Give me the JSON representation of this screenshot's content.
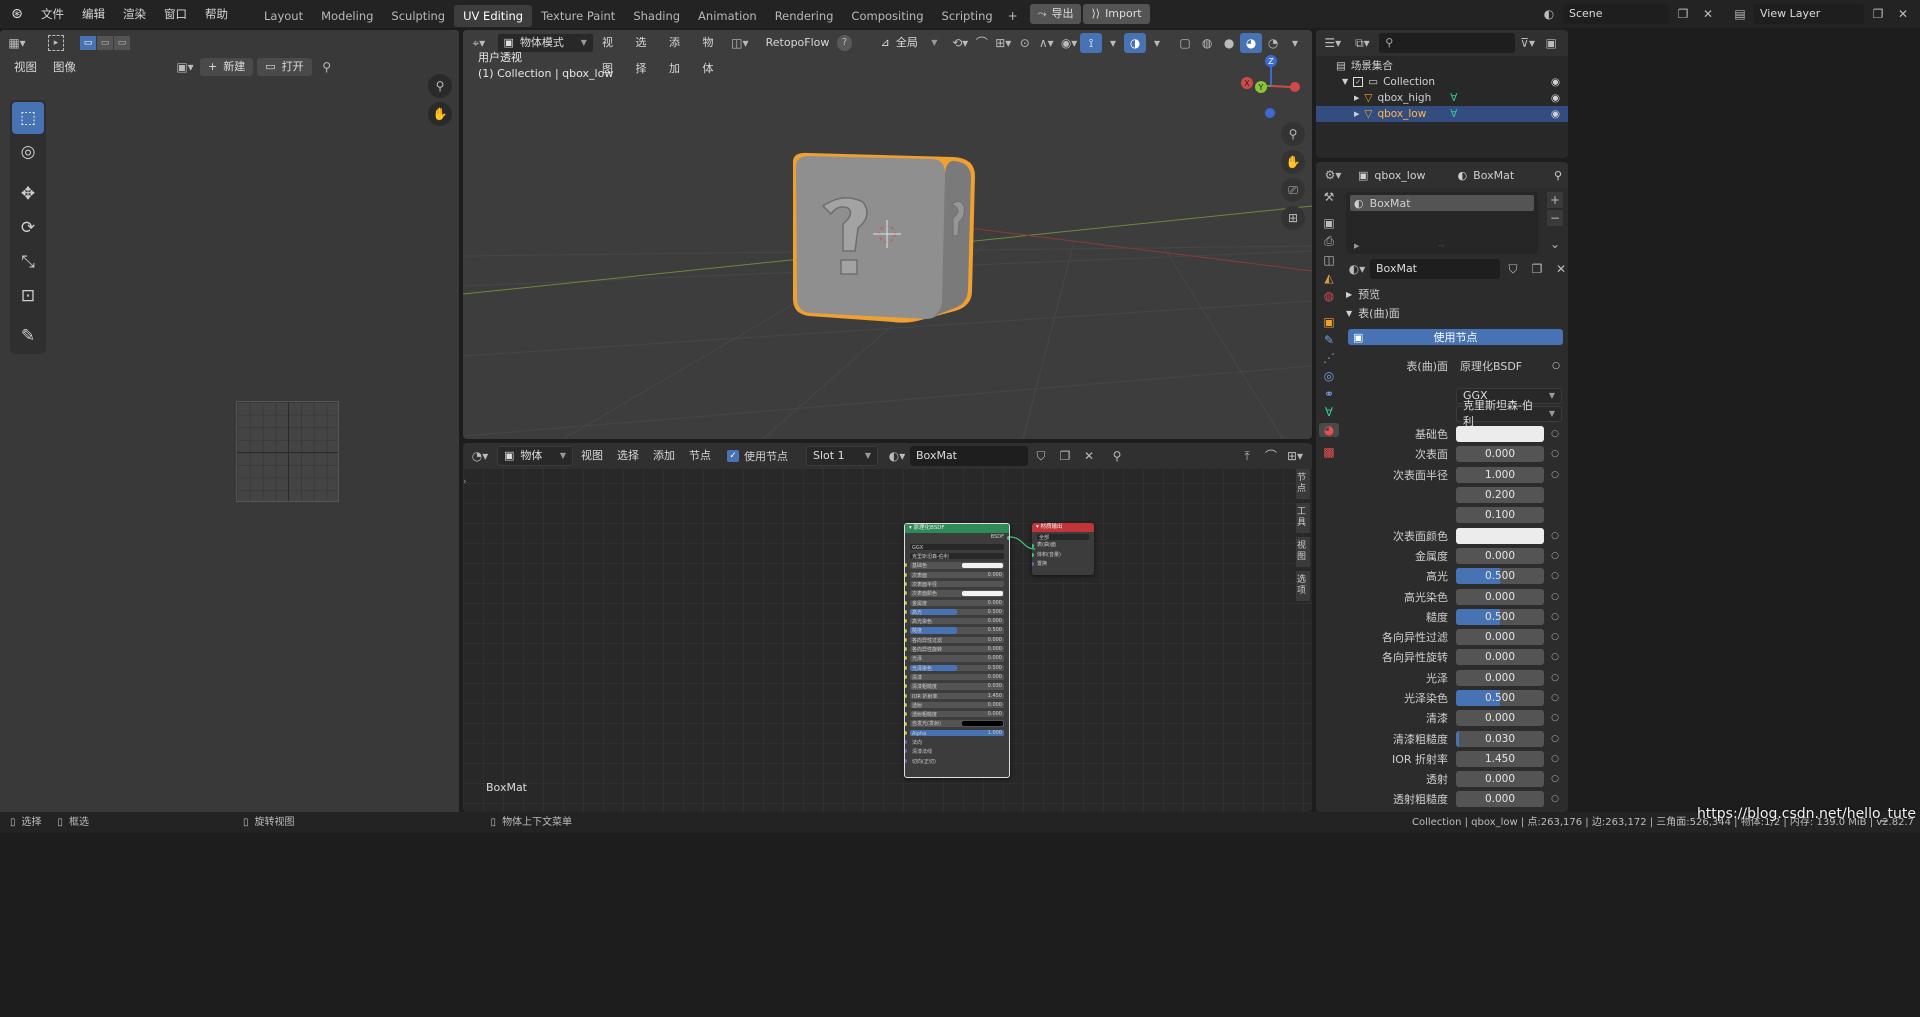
{
  "topbar": {
    "menus": [
      "文件",
      "编辑",
      "渲染",
      "窗口",
      "帮助"
    ],
    "workspaces": [
      "Layout",
      "Modeling",
      "Sculpting",
      "UV Editing",
      "Texture Paint",
      "Shading",
      "Animation",
      "Rendering",
      "Compositing",
      "Scripting"
    ],
    "active_workspace": "UV Editing",
    "export_label": "导出",
    "import_label": "Import",
    "scene": "Scene",
    "view_layer": "View Layer"
  },
  "uv_editor": {
    "menus": [
      "视图",
      "图像"
    ],
    "new_label": "新建",
    "open_label": "打开"
  },
  "viewport": {
    "mode": "物体模式",
    "menus": [
      "视图",
      "选择",
      "添加",
      "物体"
    ],
    "addon": "RetopoFlow",
    "orientation": "全局",
    "overlay_title": "用户透视",
    "overlay_subtitle": "(1) Collection | qbox_low",
    "gizmo_axes": [
      "Z",
      "Y",
      "X"
    ]
  },
  "node_editor": {
    "type": "物体",
    "menus": [
      "视图",
      "选择",
      "添加",
      "节点"
    ],
    "use_nodes_label": "使用节点",
    "slot": "Slot 1",
    "material": "BoxMat",
    "footer_label": "BoxMat",
    "side_tabs": [
      "节点",
      "工具",
      "视图",
      "选项"
    ],
    "bsdf_node": {
      "title": "原理化BSDF",
      "output": "BSDF",
      "distribution": "GGX",
      "subsurface_method": "克里斯坦森-伯利",
      "rows": [
        {
          "label": "基础色",
          "value": "",
          "color": "#f2f2f2"
        },
        {
          "label": "次表面",
          "value": "0.000"
        },
        {
          "label": "次表面半径",
          "value": ""
        },
        {
          "label": "次表面颜色",
          "value": "",
          "color": "#f2f2f2"
        },
        {
          "label": "金属度",
          "value": "0.000"
        },
        {
          "label": "高光",
          "value": "0.500",
          "fill": 0.5
        },
        {
          "label": "高光染色",
          "value": "0.000"
        },
        {
          "label": "糙度",
          "value": "0.500",
          "fill": 0.5
        },
        {
          "label": "各向异性过滤",
          "value": "0.000"
        },
        {
          "label": "各向异性旋转",
          "value": "0.000"
        },
        {
          "label": "光泽",
          "value": "0.000"
        },
        {
          "label": "光泽染色",
          "value": "0.500",
          "fill": 0.5
        },
        {
          "label": "清漆",
          "value": "0.000"
        },
        {
          "label": "清漆粗糙度",
          "value": "0.030"
        },
        {
          "label": "IOR 折射率",
          "value": "1.450"
        },
        {
          "label": "透射",
          "value": "0.000"
        },
        {
          "label": "透射粗糙度",
          "value": "0.000"
        },
        {
          "label": "自发光(发射)",
          "value": "",
          "color": "#000000"
        },
        {
          "label": "Alpha",
          "value": "1.000",
          "fill": 1.0
        },
        {
          "label": "法向",
          "value": ""
        },
        {
          "label": "清漆法线",
          "value": ""
        },
        {
          "label": "切向(正切)",
          "value": ""
        }
      ]
    },
    "output_node": {
      "title": "材质输出",
      "target": "全部",
      "inputs": [
        "表(曲)面",
        "体积(音量)",
        "置换"
      ]
    }
  },
  "outliner": {
    "root": "场景集合",
    "collection": "Collection",
    "objects": [
      "qbox_high",
      "qbox_low"
    ],
    "selected": "qbox_low"
  },
  "properties": {
    "object": "qbox_low",
    "material": "BoxMat",
    "slot_name": "BoxMat",
    "material_field": "BoxMat",
    "preview_label": "预览",
    "surface_label": "表(曲)面",
    "use_nodes_button": "使用节点",
    "surface_shader_label": "表(曲)面",
    "surface_shader": "原理化BSDF",
    "distribution": "GGX",
    "subsurface_method": "克里斯坦森-伯利",
    "rows": [
      {
        "label": "基础色",
        "value": "",
        "color": "#ececec"
      },
      {
        "label": "次表面",
        "value": "0.000"
      },
      {
        "label": "次表面半径",
        "value": "1.000"
      },
      {
        "label": "",
        "value": "0.200"
      },
      {
        "label": "",
        "value": "0.100"
      },
      {
        "label": "次表面颜色",
        "value": "",
        "color": "#ececec"
      },
      {
        "label": "金属度",
        "value": "0.000"
      },
      {
        "label": "高光",
        "value": "0.500",
        "fill": 0.5
      },
      {
        "label": "高光染色",
        "value": "0.000"
      },
      {
        "label": "糙度",
        "value": "0.500",
        "fill": 0.5
      },
      {
        "label": "各向异性过滤",
        "value": "0.000"
      },
      {
        "label": "各向异性旋转",
        "value": "0.000"
      },
      {
        "label": "光泽",
        "value": "0.000"
      },
      {
        "label": "光泽染色",
        "value": "0.500",
        "fill": 0.5
      },
      {
        "label": "清漆",
        "value": "0.000"
      },
      {
        "label": "清漆粗糙度",
        "value": "0.030",
        "fill": 0.03
      },
      {
        "label": "IOR 折射率",
        "value": "1.450"
      },
      {
        "label": "透射",
        "value": "0.000"
      },
      {
        "label": "透射粗糙度",
        "value": "0.000"
      }
    ]
  },
  "statusbar": {
    "select": "选择",
    "box_select": "框选",
    "rotate_view": "旋转视图",
    "context_menu": "物体上下文菜单",
    "stats": "Collection | qbox_low | 点:263,176 | 边:263,172 | 三角面:526,344 | 物体:1/2 | 内存: 139.0 MiB | v2.82.7",
    "watermark": "https://blog.csdn.net/hello_tute"
  },
  "colors": {
    "accent": "#4772b3",
    "selection_outline": "#f0a030",
    "bsdf_header": "#2e8b57",
    "output_header": "#c0353a"
  }
}
